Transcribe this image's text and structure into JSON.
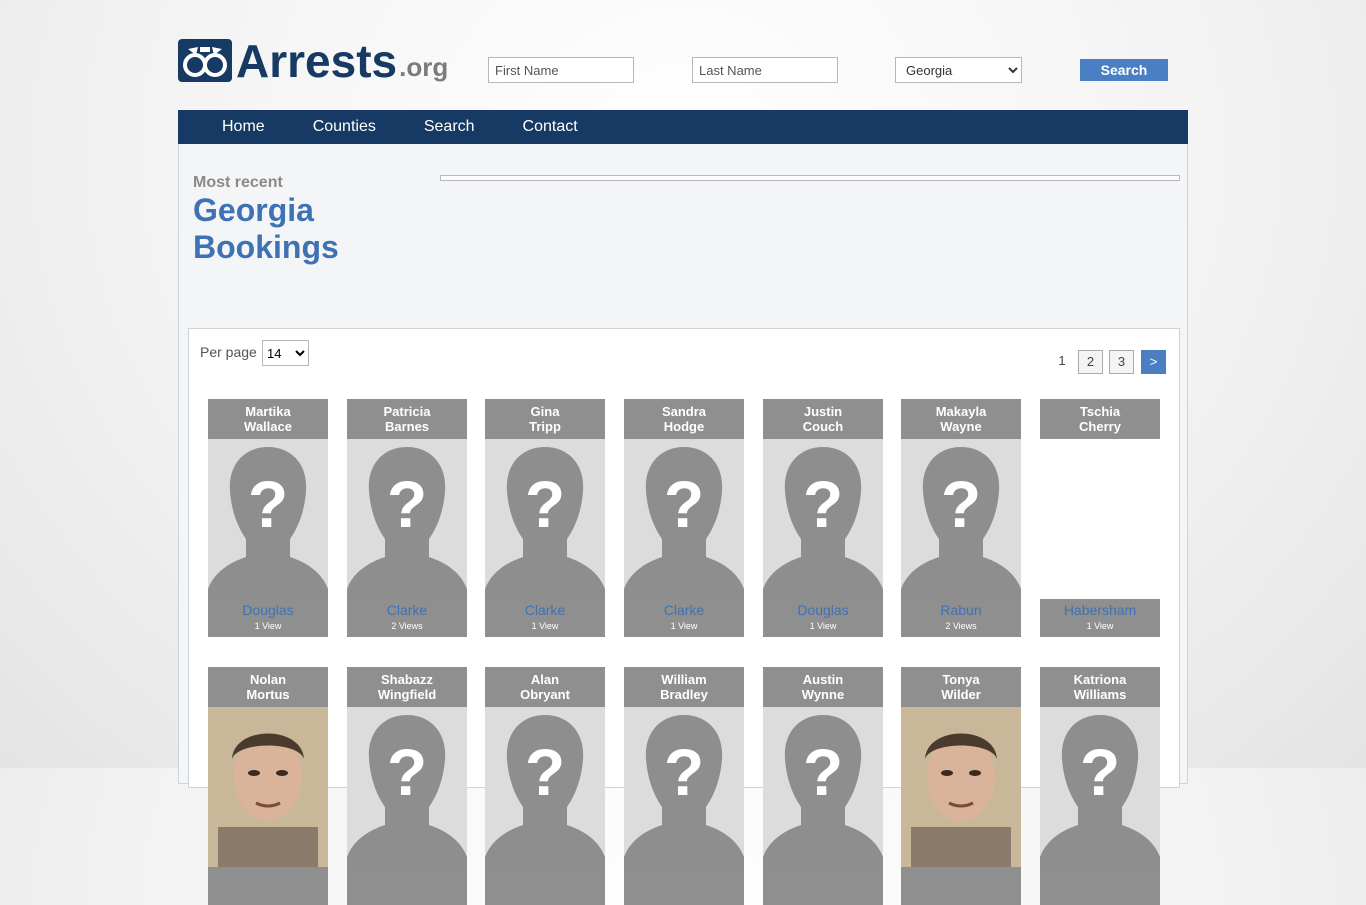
{
  "logo": {
    "name": "Arrests",
    "suffix": ".org"
  },
  "search": {
    "first_name_placeholder": "First Name",
    "last_name_placeholder": "Last Name",
    "state_selected": "Georgia",
    "button_label": "Search"
  },
  "nav": {
    "items": [
      "Home",
      "Counties",
      "Search",
      "Contact"
    ]
  },
  "heading": {
    "kicker": "Most recent",
    "title": "Georgia Bookings"
  },
  "listing": {
    "per_page_label": "Per page",
    "per_page_value": "14",
    "pagination": {
      "current": "1",
      "pages": [
        "2",
        "3"
      ],
      "next": ">"
    }
  },
  "bookings": [
    {
      "first": "Martika",
      "last": "Wallace",
      "county": "Douglas",
      "views": "1 View",
      "photo": "placeholder-silhouette"
    },
    {
      "first": "Patricia",
      "last": "Barnes",
      "county": "Clarke",
      "views": "2 Views",
      "photo": "placeholder-silhouette"
    },
    {
      "first": "Gina",
      "last": "Tripp",
      "county": "Clarke",
      "views": "1 View",
      "photo": "placeholder-silhouette"
    },
    {
      "first": "Sandra",
      "last": "Hodge",
      "county": "Clarke",
      "views": "1 View",
      "photo": "placeholder-silhouette"
    },
    {
      "first": "Justin",
      "last": "Couch",
      "county": "Douglas",
      "views": "1 View",
      "photo": "placeholder-silhouette"
    },
    {
      "first": "Makayla",
      "last": "Wayne",
      "county": "Rabun",
      "views": "2 Views",
      "photo": "placeholder-silhouette"
    },
    {
      "first": "Tschia",
      "last": "Cherry",
      "county": "Habersham",
      "views": "1 View",
      "photo": "none"
    },
    {
      "first": "Nolan",
      "last": "Mortus",
      "county": "",
      "views": "",
      "photo": "mugshot"
    },
    {
      "first": "Shabazz",
      "last": "Wingfield",
      "county": "",
      "views": "",
      "photo": "placeholder-silhouette"
    },
    {
      "first": "Alan",
      "last": "Obryant",
      "county": "",
      "views": "",
      "photo": "placeholder-silhouette"
    },
    {
      "first": "William",
      "last": "Bradley",
      "county": "",
      "views": "",
      "photo": "placeholder-silhouette"
    },
    {
      "first": "Austin",
      "last": "Wynne",
      "county": "",
      "views": "",
      "photo": "placeholder-silhouette"
    },
    {
      "first": "Tonya",
      "last": "Wilder",
      "county": "",
      "views": "",
      "photo": "mugshot"
    },
    {
      "first": "Katriona",
      "last": "Williams",
      "county": "",
      "views": "",
      "photo": "placeholder-silhouette"
    }
  ]
}
